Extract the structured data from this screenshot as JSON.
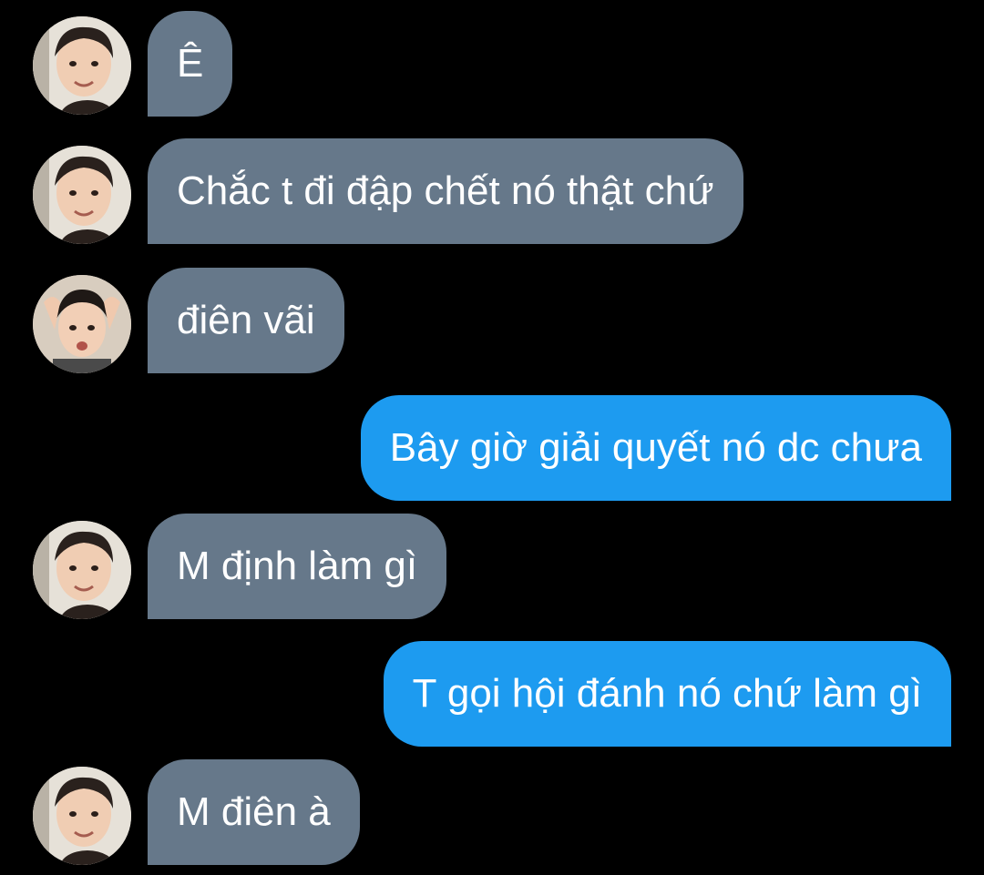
{
  "conversation": {
    "messages": [
      {
        "direction": "incoming",
        "avatar": "avatar-a",
        "text": "Ê"
      },
      {
        "direction": "incoming",
        "avatar": "avatar-a",
        "text": "Chắc t đi đập chết nó thật chứ"
      },
      {
        "direction": "incoming",
        "avatar": "avatar-b",
        "text": "điên vãi"
      },
      {
        "direction": "outgoing",
        "text": "Bây giờ giải quyết nó dc chưa"
      },
      {
        "direction": "incoming",
        "avatar": "avatar-a",
        "text": "M định làm gì"
      },
      {
        "direction": "outgoing",
        "text": "T gọi hội đánh nó chứ làm gì"
      },
      {
        "direction": "incoming",
        "avatar": "avatar-a",
        "text": "M điên à"
      }
    ]
  },
  "colors": {
    "background": "#000000",
    "incoming_bubble": "#66788a",
    "outgoing_bubble": "#1d9bf0",
    "text": "#ffffff"
  }
}
